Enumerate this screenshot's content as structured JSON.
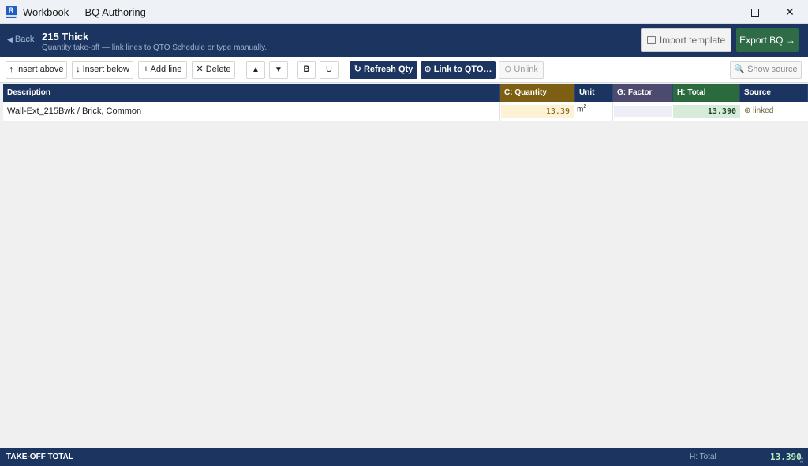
{
  "window": {
    "title": "Workbook — BQ Authoring",
    "app_icon_letter": "R",
    "controls": {
      "minimize": "minimize",
      "maximize": "maximize",
      "close": "✕"
    }
  },
  "header": {
    "back_label": "Back",
    "title": "215 Thick",
    "subtitle": "Quantity take-off — link lines to QTO Schedule or type manually.",
    "import_template_label": "Import template",
    "export_label": "Export BQ →"
  },
  "toolbar": {
    "insert_above": "↑ Insert above",
    "insert_below": "↓ Insert below",
    "add_line": "+ Add line",
    "delete": "✕ Delete",
    "move_up": "▲",
    "move_down": "▼",
    "bold": "B",
    "underline": "U",
    "refresh_qty": "↻ Refresh Qty",
    "link_qto": "⊕ Link to QTO…",
    "unlink": "⊖ Unlink",
    "show_source": "🔍 Show source"
  },
  "grid": {
    "columns": {
      "description": "Description",
      "quantity": "C: Quantity",
      "unit": "Unit",
      "factor": "G: Factor",
      "total": "H: Total",
      "source": "Source"
    },
    "rows": [
      {
        "description": "Wall-Ext_215Bwk / Brick, Common",
        "quantity": "13.39",
        "unit_base": "m",
        "unit_exp": "2",
        "factor": "",
        "total": "13.390",
        "source": "⊕ linked"
      }
    ]
  },
  "footer": {
    "label": "TAKE-OFF TOTAL",
    "total_label": "H: Total",
    "total_value": "13.390"
  },
  "colors": {
    "navy": "#1c3560",
    "quantity_header": "#7d5f13",
    "factor_header": "#4c4a6e",
    "total_header": "#2a6a3c",
    "export_button": "#2f6b46"
  }
}
